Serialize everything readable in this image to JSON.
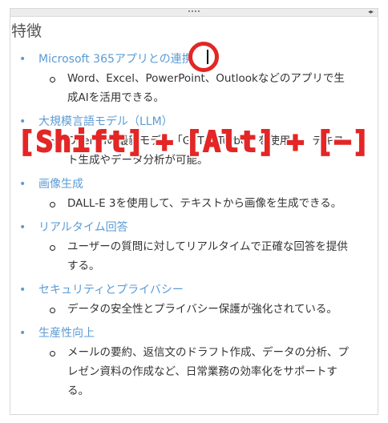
{
  "title": "特徴",
  "items": [
    {
      "heading": "Microsoft 365アプリとの連携",
      "detail": "Word、Excel、PowerPoint、Outlookなどのアプリで生成AIを活用できる。"
    },
    {
      "heading": "大規模言語モデル（LLM）",
      "detail": "OpenAIの最新モデル「GPT-4 Turbo」を使用し、テキスト生成やデータ分析が可能。"
    },
    {
      "heading": "画像生成",
      "detail": "DALL-E 3を使用して、テキストから画像を生成できる。"
    },
    {
      "heading": "リアルタイム回答",
      "detail": "ユーザーの質問に対してリアルタイムで正確な回答を提供する。"
    },
    {
      "heading": "セキュリティとプライバシー",
      "detail": "データの安全性とプライバシー保護が強化されている。"
    },
    {
      "heading": "生産性向上",
      "detail": "メールの要約、返信文のドラフト作成、データの分析、プレゼン資料の作成など、日常業務の効率化をサポートする。"
    }
  ],
  "shortcut": {
    "key1": "[Shift]",
    "plus1": "+",
    "key2": "[Alt]",
    "plus2": "+",
    "key3": "[−]"
  },
  "colors": {
    "heading": "#5b9bd5",
    "annotation": "#e32626"
  }
}
